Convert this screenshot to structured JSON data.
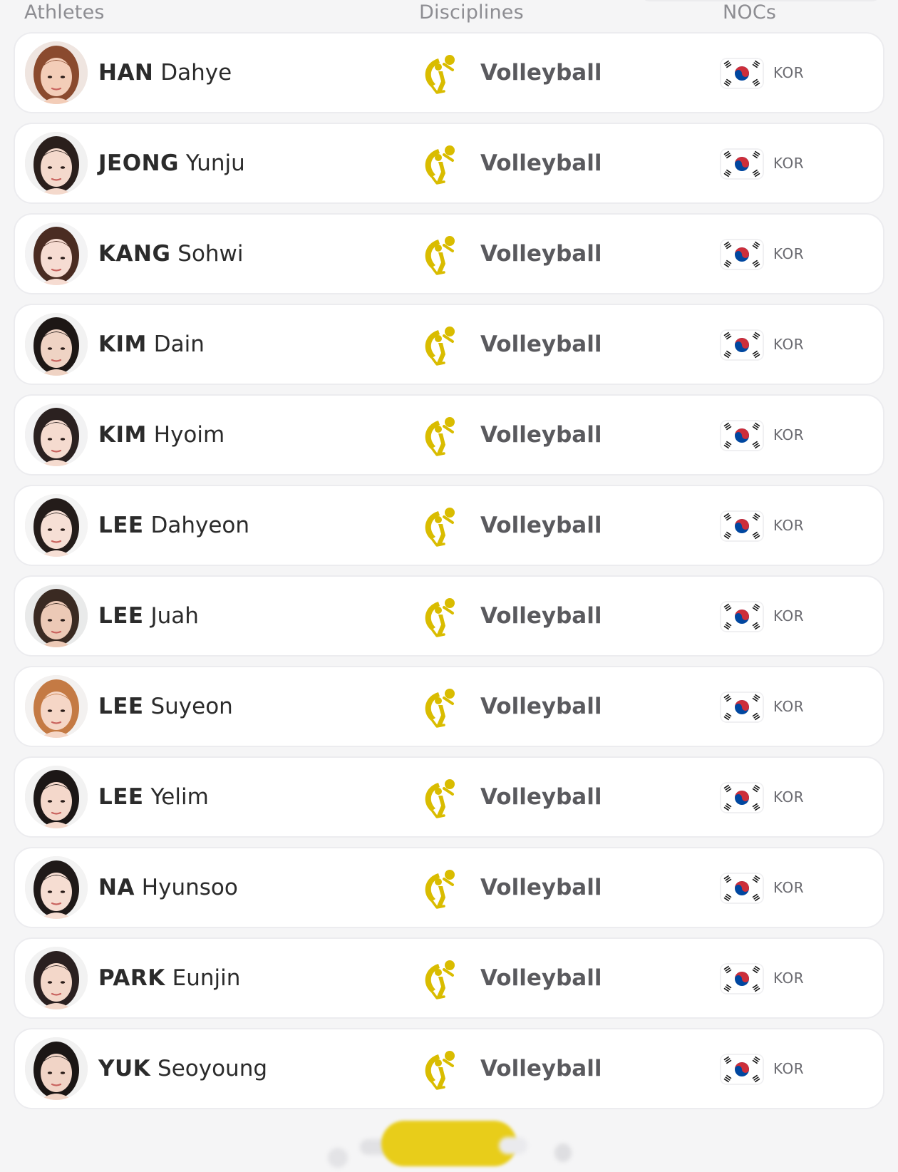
{
  "header": {
    "athletes": "Athletes",
    "disciplines": "Disciplines",
    "nocs": "NOCs"
  },
  "colors": {
    "discipline_icon": "#d9bc00",
    "flag_red": "#cd2e3a",
    "flag_blue": "#0047a0",
    "footer_button": "#e8cd1a"
  },
  "athletes": [
    {
      "last": "HAN",
      "first": "Dahye",
      "discipline": "Volleyball",
      "noc": "KOR",
      "hair": "#8a4a2e",
      "skin": "#f3cdb8",
      "bg": "#efe5e0"
    },
    {
      "last": "JEONG",
      "first": "Yunju",
      "discipline": "Volleyball",
      "noc": "KOR",
      "hair": "#2a1f1c",
      "skin": "#f4d9cc",
      "bg": "#f1f1f1"
    },
    {
      "last": "KANG",
      "first": "Sohwi",
      "discipline": "Volleyball",
      "noc": "KOR",
      "hair": "#4a2c22",
      "skin": "#f6dcd2",
      "bg": "#f3f3f4"
    },
    {
      "last": "KIM",
      "first": "Dain",
      "discipline": "Volleyball",
      "noc": "KOR",
      "hair": "#1d1715",
      "skin": "#efd3c4",
      "bg": "#f2f2f2"
    },
    {
      "last": "KIM",
      "first": "Hyoim",
      "discipline": "Volleyball",
      "noc": "KOR",
      "hair": "#2b2120",
      "skin": "#f5dbcf",
      "bg": "#f2f2f3"
    },
    {
      "last": "LEE",
      "first": "Dahyeon",
      "discipline": "Volleyball",
      "noc": "KOR",
      "hair": "#241c1a",
      "skin": "#f6dfd5",
      "bg": "#f4f4f4"
    },
    {
      "last": "LEE",
      "first": "Juah",
      "discipline": "Volleyball",
      "noc": "KOR",
      "hair": "#3a2a22",
      "skin": "#ecc9b6",
      "bg": "#e9eaea"
    },
    {
      "last": "LEE",
      "first": "Suyeon",
      "discipline": "Volleyball",
      "noc": "KOR",
      "hair": "#c47a44",
      "skin": "#f5d6c6",
      "bg": "#f3f1f0"
    },
    {
      "last": "LEE",
      "first": "Yelim",
      "discipline": "Volleyball",
      "noc": "KOR",
      "hair": "#1c1716",
      "skin": "#f4d8cb",
      "bg": "#f2f2f2"
    },
    {
      "last": "NA",
      "first": "Hyunsoo",
      "discipline": "Volleyball",
      "noc": "KOR",
      "hair": "#1f1918",
      "skin": "#f6ddd2",
      "bg": "#f3f3f3"
    },
    {
      "last": "PARK",
      "first": "Eunjin",
      "discipline": "Volleyball",
      "noc": "KOR",
      "hair": "#2a2020",
      "skin": "#f3d7c9",
      "bg": "#f2f2f2"
    },
    {
      "last": "YUK",
      "first": "Seoyoung",
      "discipline": "Volleyball",
      "noc": "KOR",
      "hair": "#1b1615",
      "skin": "#f1d4c6",
      "bg": "#f1f1f1"
    }
  ]
}
